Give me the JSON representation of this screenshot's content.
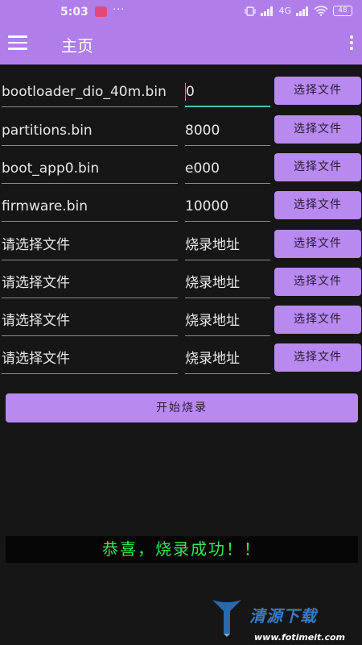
{
  "status_bar": {
    "time": "5:03",
    "dots": "···",
    "signal_text": "4G",
    "battery": "48"
  },
  "app_bar": {
    "title": "主页"
  },
  "rows": [
    {
      "file": "bootloader_dio_40m.bin",
      "addr": "0",
      "button": "选择文件"
    },
    {
      "file": "partitions.bin",
      "addr": "8000",
      "button": "选择文件"
    },
    {
      "file": "boot_app0.bin",
      "addr": "e000",
      "button": "选择文件"
    },
    {
      "file": "firmware.bin",
      "addr": "10000",
      "button": "选择文件"
    },
    {
      "file": "请选择文件",
      "addr": "烧录地址",
      "button": "选择文件"
    },
    {
      "file": "请选择文件",
      "addr": "烧录地址",
      "button": "选择文件"
    },
    {
      "file": "请选择文件",
      "addr": "烧录地址",
      "button": "选择文件"
    },
    {
      "file": "请选择文件",
      "addr": "烧录地址",
      "button": "选择文件"
    }
  ],
  "start_button": "开始烧录",
  "result_message": "恭喜，烧录成功！！",
  "watermark": {
    "text": "清源下载",
    "url": "www.fotimeit.com"
  },
  "colors": {
    "accent": "#b07ee8",
    "button": "#b889ee",
    "background": "#161616",
    "success_text": "#34e85a",
    "focus_underline": "#43c6b8"
  }
}
